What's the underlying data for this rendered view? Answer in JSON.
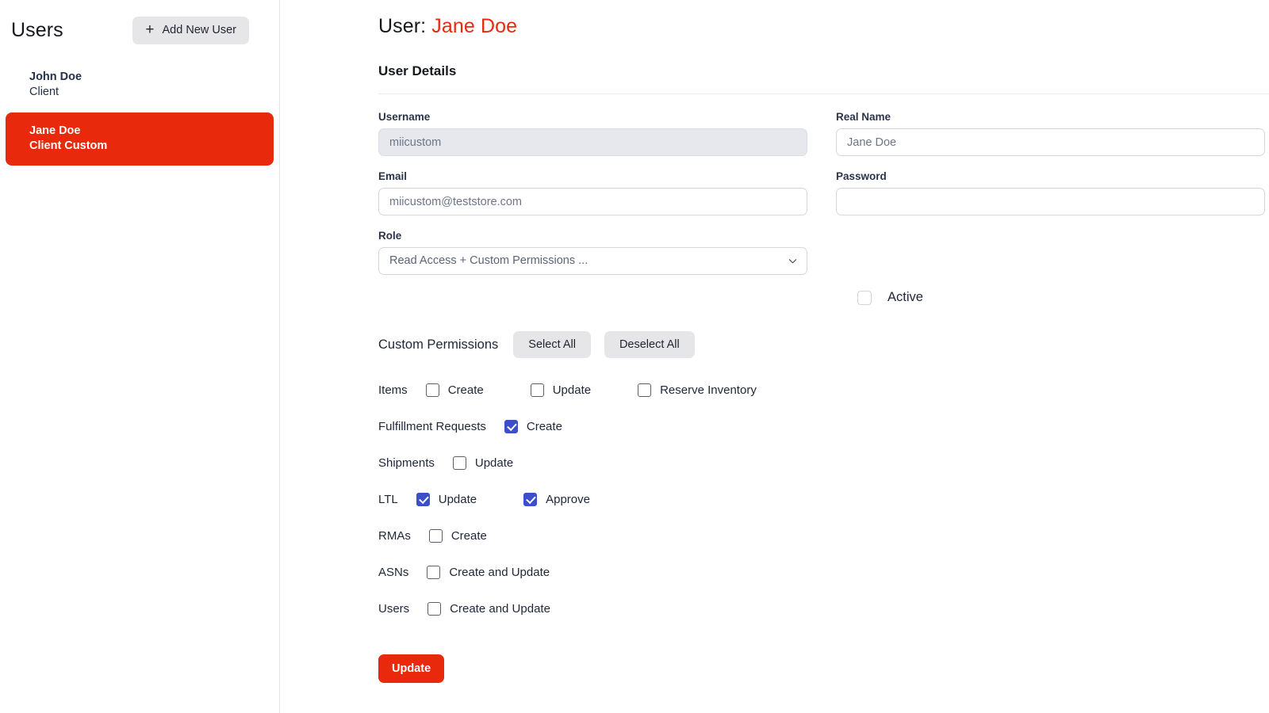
{
  "sidebar": {
    "title": "Users",
    "add_button_label": "Add New User",
    "users": [
      {
        "name": "John Doe",
        "role": "Client",
        "selected": false
      },
      {
        "name": "Jane Doe",
        "role": "Client Custom",
        "selected": true
      }
    ]
  },
  "header": {
    "title_prefix": "User:",
    "title_name": "Jane Doe",
    "section_title": "User Details"
  },
  "form": {
    "username": {
      "label": "Username",
      "value": "miicustom",
      "placeholder": "miicustom",
      "disabled": true
    },
    "real_name": {
      "label": "Real Name",
      "value": "Jane Doe",
      "placeholder": "Jane Doe"
    },
    "email": {
      "label": "Email",
      "value": "miicustom@teststore.com",
      "placeholder": "miicustom@teststore.com"
    },
    "password": {
      "label": "Password",
      "value": "",
      "placeholder": ""
    },
    "role": {
      "label": "Role",
      "selected": "Read Access + Custom Permissions ..."
    },
    "active": {
      "label": "Active",
      "checked": false
    }
  },
  "permissions": {
    "title": "Custom Permissions",
    "select_all_label": "Select All",
    "deselect_all_label": "Deselect All",
    "rows": [
      {
        "label": "Items",
        "options": [
          {
            "label": "Create",
            "checked": false
          },
          {
            "label": "Update",
            "checked": false
          },
          {
            "label": "Reserve Inventory",
            "checked": false
          }
        ]
      },
      {
        "label": "Fulfillment Requests",
        "options": [
          {
            "label": "Create",
            "checked": true
          }
        ]
      },
      {
        "label": "Shipments",
        "options": [
          {
            "label": "Update",
            "checked": false
          }
        ]
      },
      {
        "label": "LTL",
        "options": [
          {
            "label": "Update",
            "checked": true
          },
          {
            "label": "Approve",
            "checked": true
          }
        ]
      },
      {
        "label": "RMAs",
        "options": [
          {
            "label": "Create",
            "checked": false
          }
        ]
      },
      {
        "label": "ASNs",
        "options": [
          {
            "label": "Create and Update",
            "checked": false
          }
        ]
      },
      {
        "label": "Users",
        "options": [
          {
            "label": "Create and Update",
            "checked": false
          }
        ]
      }
    ]
  },
  "footer": {
    "update_label": "Update"
  },
  "colors": {
    "brand_red": "#e8290b",
    "checkbox_blue": "#3b4fc8",
    "pill_gray": "#e6e6e8",
    "input_disabled": "#e6e8ee"
  },
  "icons": {
    "plus": "+",
    "chevron_down": "chevron-down-icon"
  }
}
